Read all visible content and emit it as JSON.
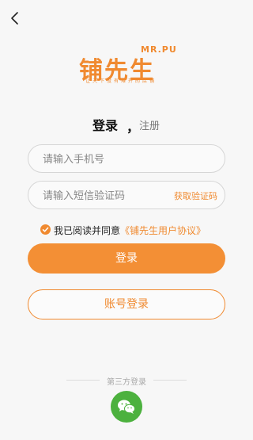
{
  "nav": {
    "back_icon": "chevron-left-icon"
  },
  "brand": {
    "logo_en": "MR.PU",
    "logo_cn": "铺先生",
    "slogan": "让天下没有难开的店铺",
    "color": "#f08a30"
  },
  "tabs": {
    "login": "登录",
    "separator": "，",
    "register": "注册"
  },
  "form": {
    "phone_placeholder": "请输入手机号",
    "code_placeholder": "请输入短信验证码",
    "get_code_label": "获取验证码"
  },
  "agreement": {
    "prefix": "我已阅读并同意",
    "link": "《铺先生用户协议》",
    "checked": true
  },
  "buttons": {
    "login": "登录",
    "account_login": "账号登录"
  },
  "third_party": {
    "label": "第三方登录",
    "wechat_icon": "wechat-icon",
    "wechat_color": "#4cb13e"
  }
}
